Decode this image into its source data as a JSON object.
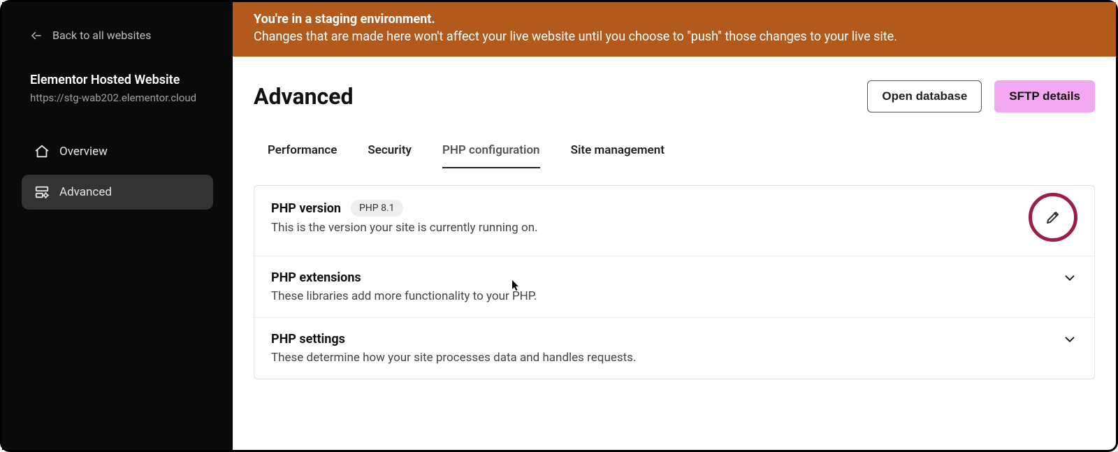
{
  "sidebar": {
    "back_label": "Back to all websites",
    "site_title": "Elementor Hosted Website",
    "site_url": "https://stg-wab202.elementor.cloud",
    "nav_overview": "Overview",
    "nav_advanced": "Advanced"
  },
  "banner": {
    "title": "You're in a staging environment.",
    "text": "Changes that are made here won't affect your live website until you choose to \"push\" those changes to your live site."
  },
  "page": {
    "title": "Advanced",
    "open_database_label": "Open database",
    "sftp_label": "SFTP details"
  },
  "tabs": {
    "performance": "Performance",
    "security": "Security",
    "php_config": "PHP configuration",
    "site_management": "Site management"
  },
  "rows": {
    "php_version": {
      "title": "PHP version",
      "badge": "PHP 8.1",
      "desc": "This is the version your site is currently running on."
    },
    "php_extensions": {
      "title": "PHP extensions",
      "desc": "These libraries add more functionality to your PHP."
    },
    "php_settings": {
      "title": "PHP settings",
      "desc": "These determine how your site processes data and handles requests."
    }
  }
}
